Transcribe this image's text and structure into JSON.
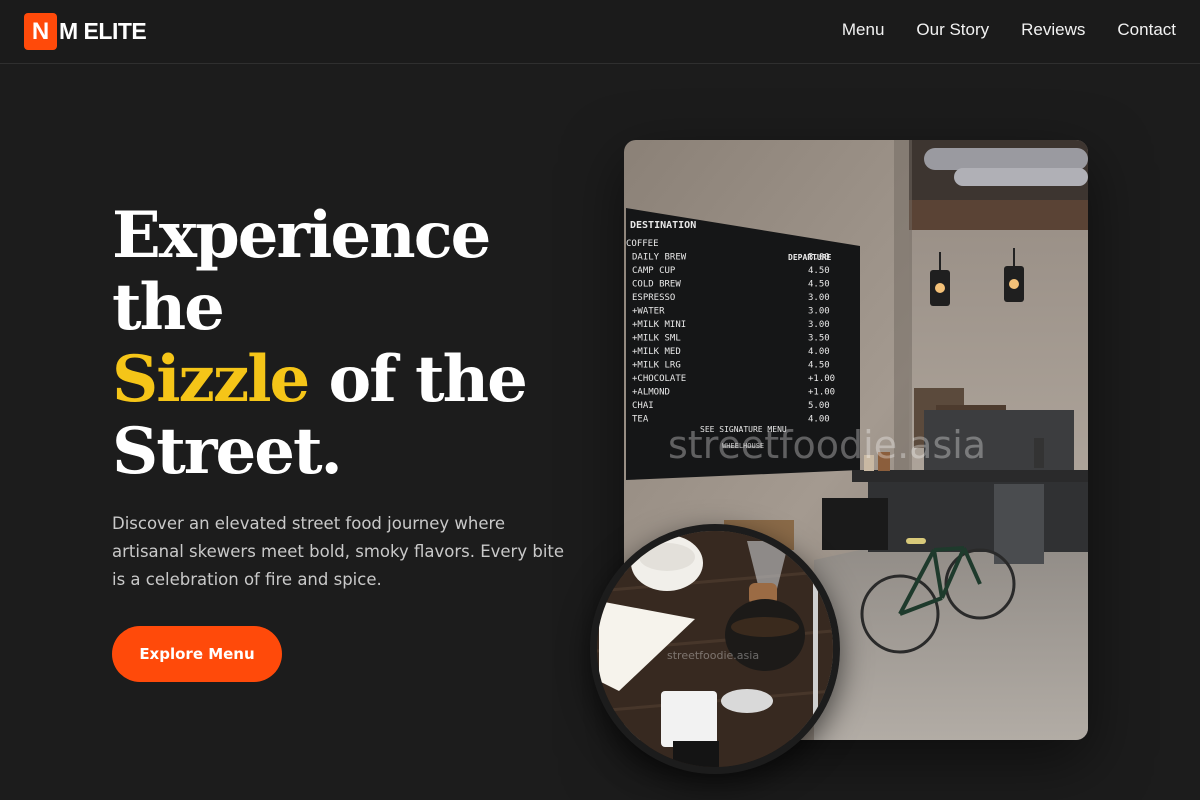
{
  "brand": {
    "mark": "N",
    "name": "M ELITE",
    "accent_color": "#ff4a0a"
  },
  "nav": {
    "items": [
      "Menu",
      "Our Story",
      "Reviews",
      "Contact"
    ]
  },
  "hero": {
    "headline_line1": "Experience",
    "headline_line2": "the",
    "headline_accent": "Sizzle",
    "headline_line3_rest": " of the",
    "headline_line4": "Street.",
    "highlight_color": "#f5c518",
    "description": "Discover an elevated street food journey where artisanal skewers meet bold, smoky flavors. Every bite is a celebration of fire and spice.",
    "cta_label": "Explore Menu"
  },
  "images": {
    "main_watermark": "streetfoodie.asia",
    "inset_watermark": "streetfoodie.asia",
    "menu_board": {
      "title": "DESTINATION",
      "column_header": "DEPARTURE",
      "items": [
        {
          "name": "COFFEE",
          "price": ""
        },
        {
          "name": "DAILY BREW",
          "price": "3.00"
        },
        {
          "name": "CAMP CUP",
          "price": "4.50"
        },
        {
          "name": "COLD BREW",
          "price": "4.50"
        },
        {
          "name": "ESPRESSO",
          "price": "3.00"
        },
        {
          "name": "+WATER",
          "price": "3.00"
        },
        {
          "name": "+MILK MINI",
          "price": "3.00"
        },
        {
          "name": "+MILK SML",
          "price": "3.50"
        },
        {
          "name": "+MILK MED",
          "price": "4.00"
        },
        {
          "name": "+MILK LRG",
          "price": "4.50"
        },
        {
          "name": "+CHOCOLATE",
          "price": "+1.00"
        },
        {
          "name": "+ALMOND",
          "price": "+1.00"
        },
        {
          "name": "CHAI",
          "price": "5.00"
        },
        {
          "name": "TEA",
          "price": "4.00"
        }
      ],
      "footer": "SEE SIGNATURE MENU",
      "footer2": "WHEELHOUSE"
    }
  }
}
